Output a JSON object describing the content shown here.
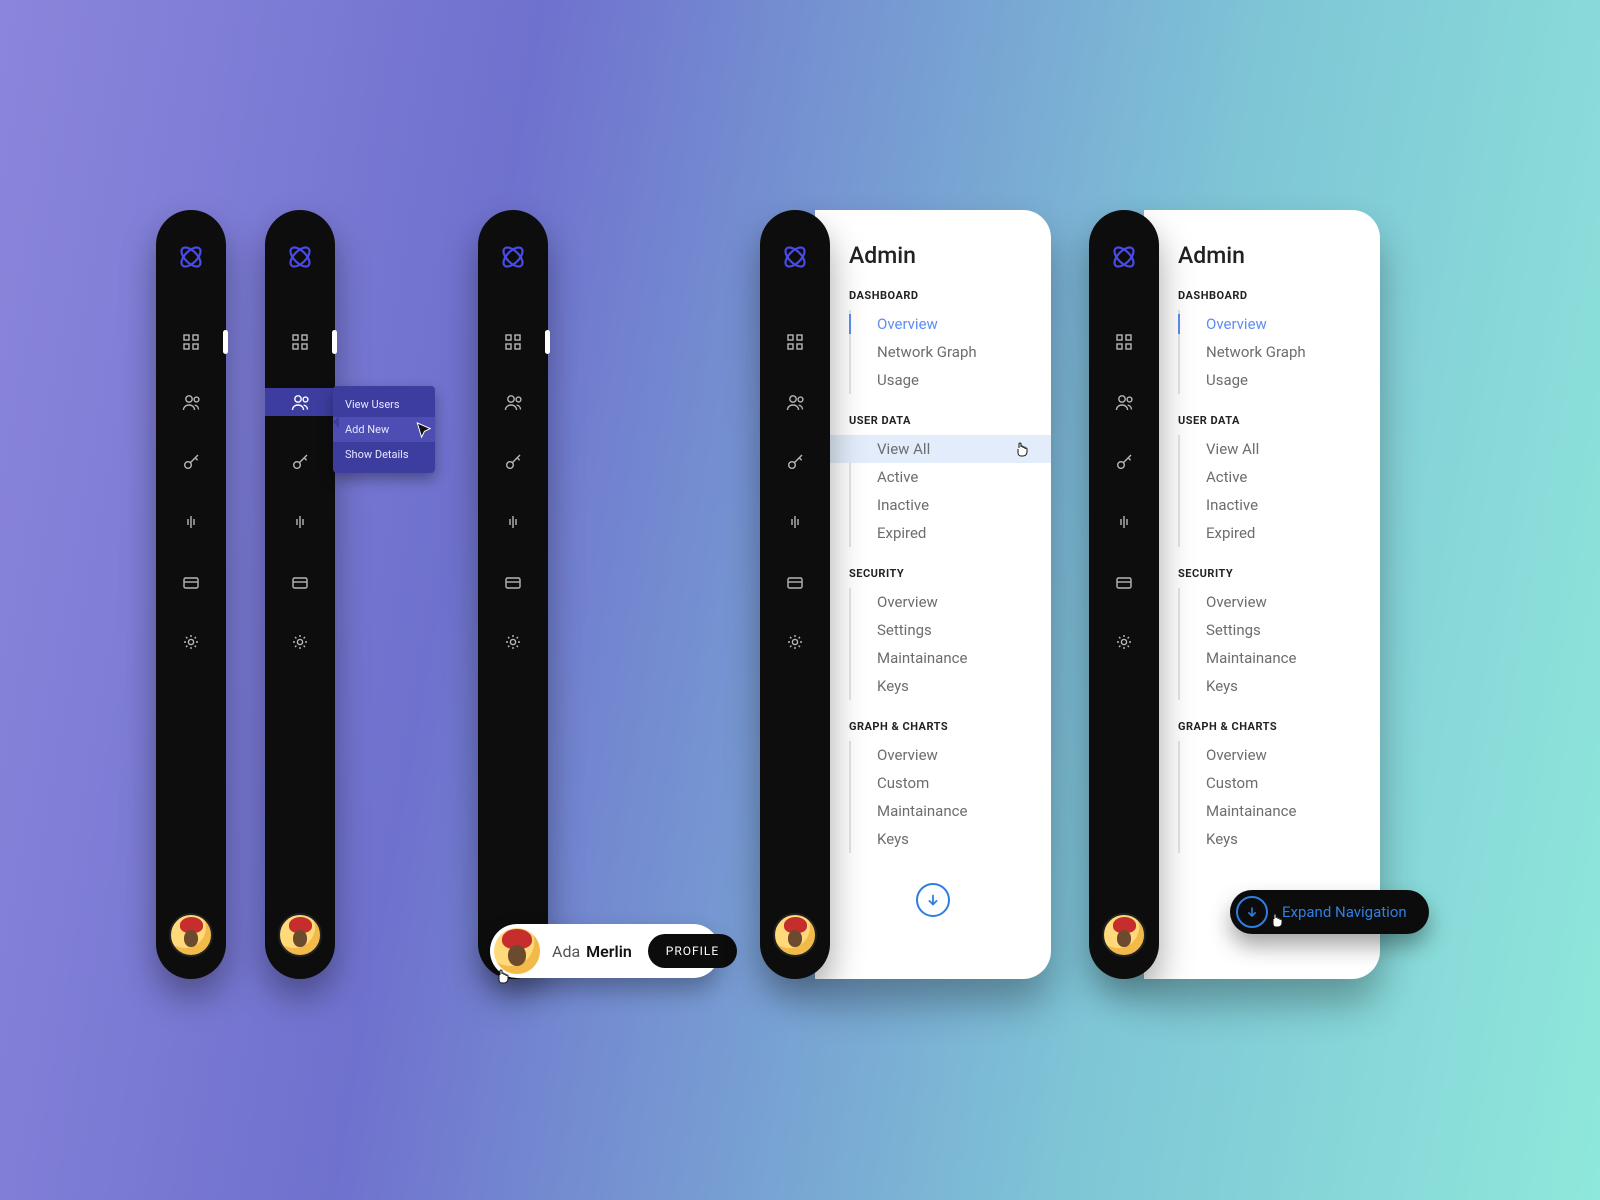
{
  "flyout": {
    "items": [
      "View Users",
      "Add New",
      "Show Details"
    ]
  },
  "profile": {
    "first": "Ada",
    "last": "Merlin",
    "button": "PROFILE"
  },
  "expand_label": "Expand Navigation",
  "panel": {
    "title": "Admin",
    "sections": [
      {
        "label": "DASHBOARD",
        "items": [
          "Overview",
          "Network Graph",
          "Usage"
        ]
      },
      {
        "label": "USER DATA",
        "items": [
          "View All",
          "Active",
          "Inactive",
          "Expired"
        ]
      },
      {
        "label": "SECURITY",
        "items": [
          "Overview",
          "Settings",
          "Maintainance",
          "Keys"
        ]
      },
      {
        "label": "GRAPH & CHARTS",
        "items": [
          "Overview",
          "Custom",
          "Maintainance",
          "Keys"
        ]
      }
    ]
  },
  "icon_names": [
    "grid-icon",
    "users-icon",
    "key-icon",
    "audio-icon",
    "card-icon",
    "gear-icon"
  ]
}
